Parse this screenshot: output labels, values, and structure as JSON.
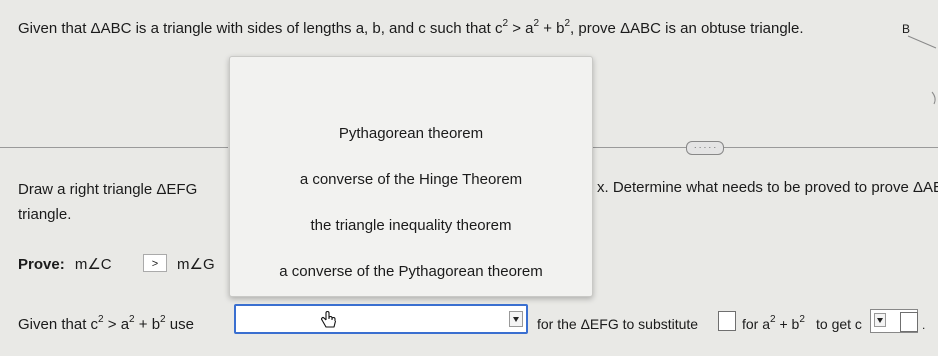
{
  "question": {
    "given_prefix": "Given that ",
    "triangle_abc": "ΔABC",
    "given_mid": " is a triangle with sides of lengths a, b, and c such that ",
    "inequality": "c² > a² + b²",
    "given_suffix": ", prove ",
    "triangle_abc2": "ΔABC",
    "given_end": " is an obtuse triangle.",
    "fig_label_b": "B"
  },
  "step1": {
    "text_left": "Draw a right triangle ΔEFG",
    "text_right": "x. Determine what needs to be proved to prove ΔAB",
    "text_line2": "triangle."
  },
  "prove": {
    "label": "Prove:",
    "left": "m∠C",
    "selected": ">",
    "right": "m∠G"
  },
  "dropdown_options": [
    "Pythagorean theorem",
    "a converse of the Hinge Theorem",
    "the triangle inequality theorem",
    "a converse of the Pythagorean theorem"
  ],
  "step2": {
    "given_prefix": "Given that ",
    "expr": "c² > a² + b²",
    "use": " use",
    "dropdown_value": "",
    "for_text": "for the ΔEFG to substitute",
    "for_word": "for",
    "expr2": "a² + b²",
    "to_get": "to get c"
  }
}
